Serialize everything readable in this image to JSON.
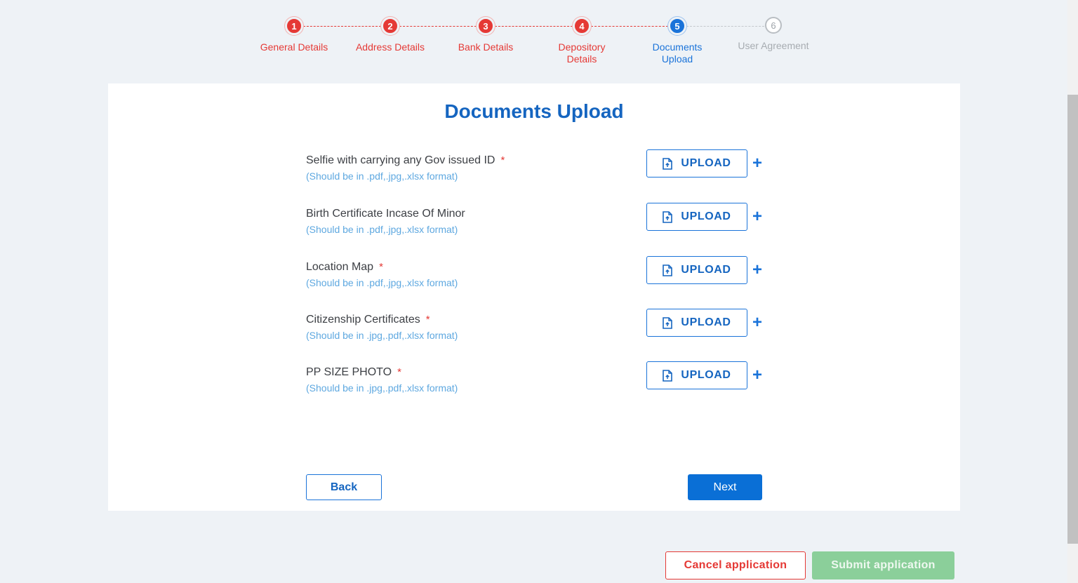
{
  "stepper": {
    "steps": [
      {
        "number": "1",
        "label": "General Details",
        "state": "done"
      },
      {
        "number": "2",
        "label": "Address Details",
        "state": "done"
      },
      {
        "number": "3",
        "label": "Bank Details",
        "state": "done"
      },
      {
        "number": "4",
        "label": "Depository Details",
        "state": "done"
      },
      {
        "number": "5",
        "label": "Documents Upload",
        "state": "active"
      },
      {
        "number": "6",
        "label": "User Agreement",
        "state": "pending"
      }
    ]
  },
  "card": {
    "title": "Documents Upload",
    "documents": [
      {
        "label": "Selfie with carrying any Gov issued ID",
        "required": "*",
        "hint": "(Should be in .pdf,.jpg,.xlsx format)"
      },
      {
        "label": "Birth Certificate Incase Of Minor",
        "required": "",
        "hint": "(Should be in .pdf,.jpg,.xlsx format)"
      },
      {
        "label": "Location Map",
        "required": "*",
        "hint": "(Should be in .pdf,.jpg,.xlsx format)"
      },
      {
        "label": "Citizenship Certificates",
        "required": "*",
        "hint": "(Should be in .jpg,.pdf,.xlsx format)"
      },
      {
        "label": "PP SIZE PHOTO",
        "required": "*",
        "hint": "(Should be in .jpg,.pdf,.xlsx format)"
      }
    ],
    "upload_label": "UPLOAD",
    "plus_symbol": "+",
    "back_label": "Back",
    "next_label": "Next"
  },
  "footer": {
    "cancel_label": "Cancel application",
    "submit_label": "Submit application"
  },
  "colors": {
    "done": "#e53935",
    "active": "#1a73d9",
    "pending": "#b9bec3",
    "submit_disabled": "#8bcf9a"
  },
  "icons": {
    "upload": "file-upload-icon",
    "add": "plus-icon"
  }
}
